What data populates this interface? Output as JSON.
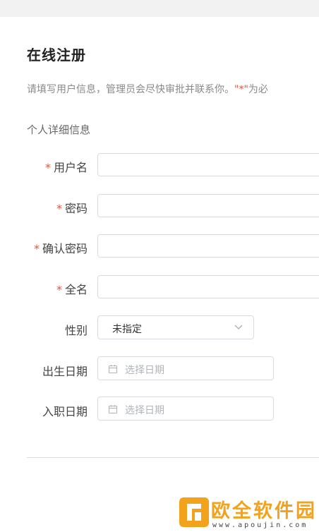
{
  "page": {
    "title": "在线注册",
    "intro_text": "请填写用户信息，管理员会尽快审批并联系你。",
    "intro_star": "\"*\"",
    "intro_suffix": "为必"
  },
  "section": {
    "title": "个人详细信息"
  },
  "form": {
    "required_mark": "*",
    "username_label": "用户名",
    "password_label": "密码",
    "confirm_password_label": "确认密码",
    "full_name_label": "全名",
    "gender_label": "性别",
    "gender_value": "未指定",
    "birthdate_label": "出生日期",
    "birthdate_placeholder": "选择日期",
    "hire_date_label": "入职日期",
    "hire_date_placeholder": "选择日期"
  },
  "watermark": {
    "name": "欧全软件园",
    "url": "www.apoujin.com"
  },
  "colors": {
    "required": "#e8503a",
    "border": "#d8dbe0",
    "muted_text": "#8a8a8a",
    "watermark": "#f2a21b"
  },
  "icons": {
    "select_arrow": "chevron-down-icon",
    "date_picker": "calendar-icon"
  }
}
